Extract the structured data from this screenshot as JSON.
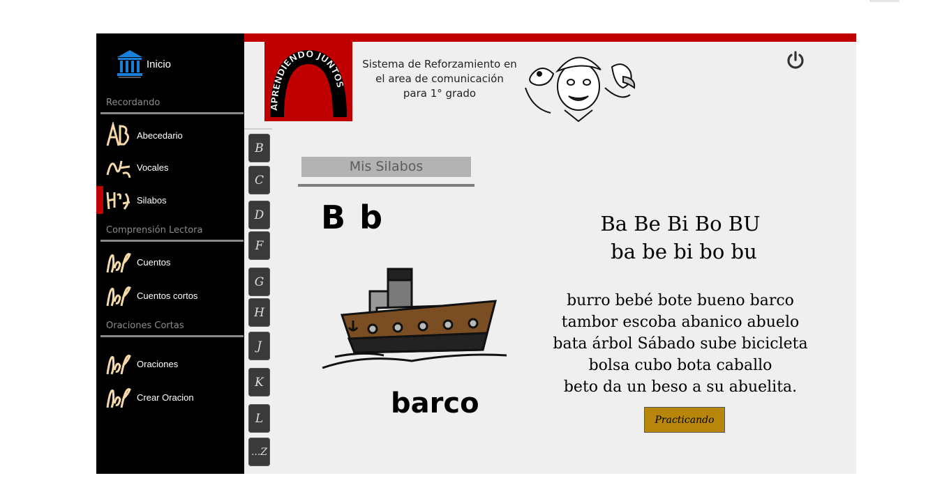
{
  "sidebar": {
    "home_label": "Inicio",
    "sections": [
      {
        "title": "Recordando",
        "items": [
          {
            "label": "Abecedario",
            "icon": "abc-icon"
          },
          {
            "label": "Vocales",
            "icon": "vowels-icon"
          },
          {
            "label": "Silabos",
            "icon": "syllables-icon",
            "active": true
          }
        ]
      },
      {
        "title": "Comprensión Lectora",
        "items": [
          {
            "label": "Cuentos",
            "icon": "reading-icon"
          },
          {
            "label": "Cuentos cortos",
            "icon": "reading-icon"
          }
        ]
      },
      {
        "title": "Oraciones Cortas",
        "items": [
          {
            "label": "Oraciones",
            "icon": "reading-icon"
          },
          {
            "label": "Crear Oracion",
            "icon": "reading-icon"
          }
        ]
      }
    ]
  },
  "header": {
    "logo_text": "APRENDIENDO JUNTOS",
    "line1": "Sistema de Reforzamiento en",
    "line2": "el area de comunicación",
    "line3": "para 1° grado"
  },
  "letters": [
    "B",
    "C",
    "D",
    "F",
    "G",
    "H",
    "J",
    "K",
    "L",
    "...Z"
  ],
  "content": {
    "section_title": "Mis Silabos",
    "letter_pair": "B b",
    "image_word": "barco",
    "syllables_upper": "Ba Be Bi Bo BU",
    "syllables_lower": "ba be bi bo bu",
    "words": [
      "burro bebé bote bueno barco",
      "tambor escoba abanico abuelo",
      "bata árbol Sábado sube bicicleta",
      "bolsa cubo bota caballo",
      "beto da un beso a su abuelita."
    ],
    "practice_button": "Practicando"
  },
  "colors": {
    "accent_red": "#c00000",
    "button_gold": "#b8860b",
    "sidebar_bg": "#000000"
  }
}
